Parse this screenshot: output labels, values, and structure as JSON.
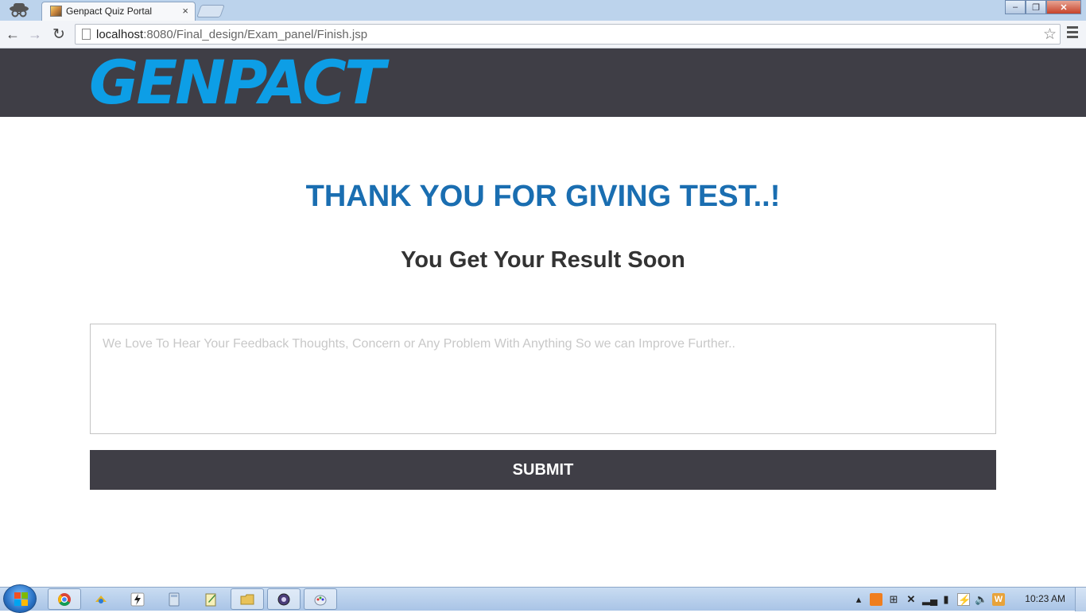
{
  "browser": {
    "tab_title": "Genpact Quiz Portal",
    "tab_close": "×",
    "url_host": "localhost",
    "url_rest": ":8080/Final_design/Exam_panel/Finish.jsp",
    "star": "☆",
    "back": "←",
    "forward": "→",
    "reload": "↻",
    "minimize": "–",
    "maximize": "❐",
    "close": "✕"
  },
  "header": {
    "logo_text": "GENPACT",
    "logo_color": "#0d9ee6",
    "background_color": "#3f3e46"
  },
  "main": {
    "heading": "THANK YOU FOR GIVING TEST..!",
    "subheading": "You Get Your Result Soon",
    "feedback_placeholder": "We Love To Hear Your Feedback Thoughts, Concern or Any Problem With Anything So we can Improve Further..",
    "feedback_value": "",
    "submit_label": "SUBMIT",
    "accent_color": "#1a6eb1"
  },
  "taskbar": {
    "apps": [
      "chrome-icon",
      "network-tool-icon",
      "flash-icon",
      "calculator-icon",
      "notepad-icon",
      "file-explorer-icon",
      "screen-capture-icon",
      "paint-icon"
    ],
    "tray_icons": [
      "show-hidden-icons-arrow",
      "xampp-icon",
      "windows-icon",
      "x-icon",
      "signal-icon",
      "power-icon",
      "flash-tray-icon",
      "volume-icon",
      "word-icon"
    ],
    "clock": "10:23 AM"
  }
}
